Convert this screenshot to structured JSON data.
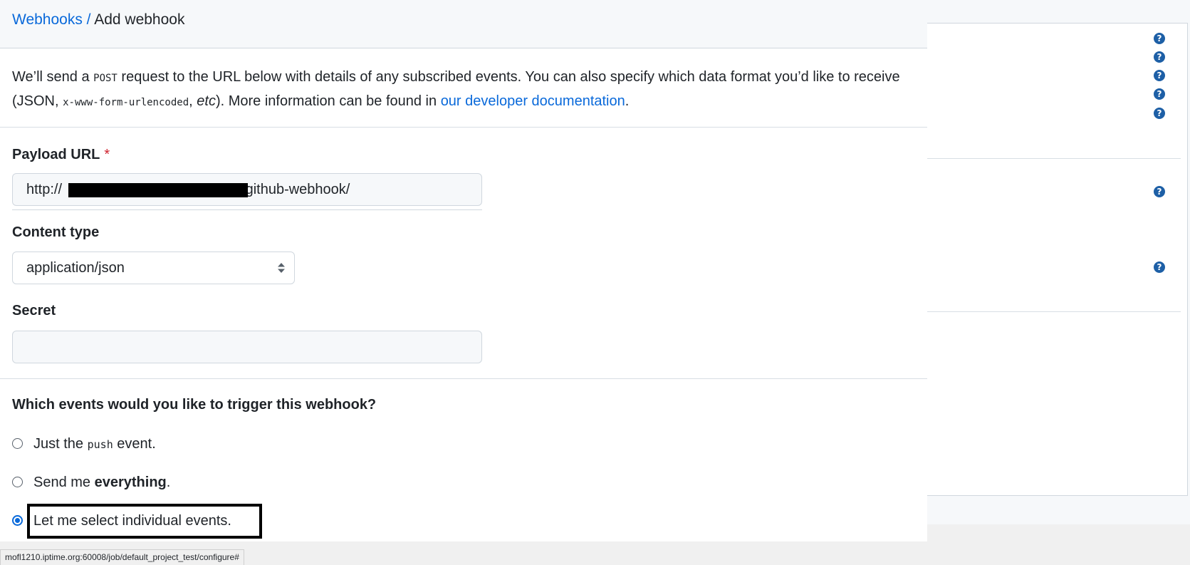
{
  "breadcrumb": {
    "parent": "Webhooks",
    "separator": " / ",
    "current": "Add webhook"
  },
  "intro": {
    "t1": "We’ll send a ",
    "code1": "POST",
    "t2": " request to the URL below with details of any subscribed events. You can also specify which data format you’d like to receive (JSON, ",
    "code2": "x-www-form-urlencoded",
    "t3": ", ",
    "em": "etc",
    "t4": "). More information can be found in ",
    "link": "our developer documentation",
    "t5": "."
  },
  "payload": {
    "label": "Payload URL",
    "required_mark": "*",
    "value_prefix": "http://",
    "value_suffix": "/github-webhook/"
  },
  "content_type": {
    "label": "Content type",
    "selected": "application/json"
  },
  "secret": {
    "label": "Secret",
    "value": ""
  },
  "events": {
    "question": "Which events would you like to trigger this webhook?",
    "options": [
      {
        "pre": "Just the ",
        "code": "push",
        "post": " event.",
        "checked": false
      },
      {
        "pre": "Send me ",
        "bold": "everything",
        "post": ".",
        "checked": false
      },
      {
        "pre": "Let me select individual events.",
        "checked": true
      }
    ]
  },
  "status_bar": {
    "url": "mofl1210.iptime.org:60008/job/default_project_test/configure#"
  },
  "help_icon_glyph": "?",
  "colors": {
    "link": "#0969da",
    "required": "#cf222e",
    "help_icon": "#1d5fa6"
  }
}
